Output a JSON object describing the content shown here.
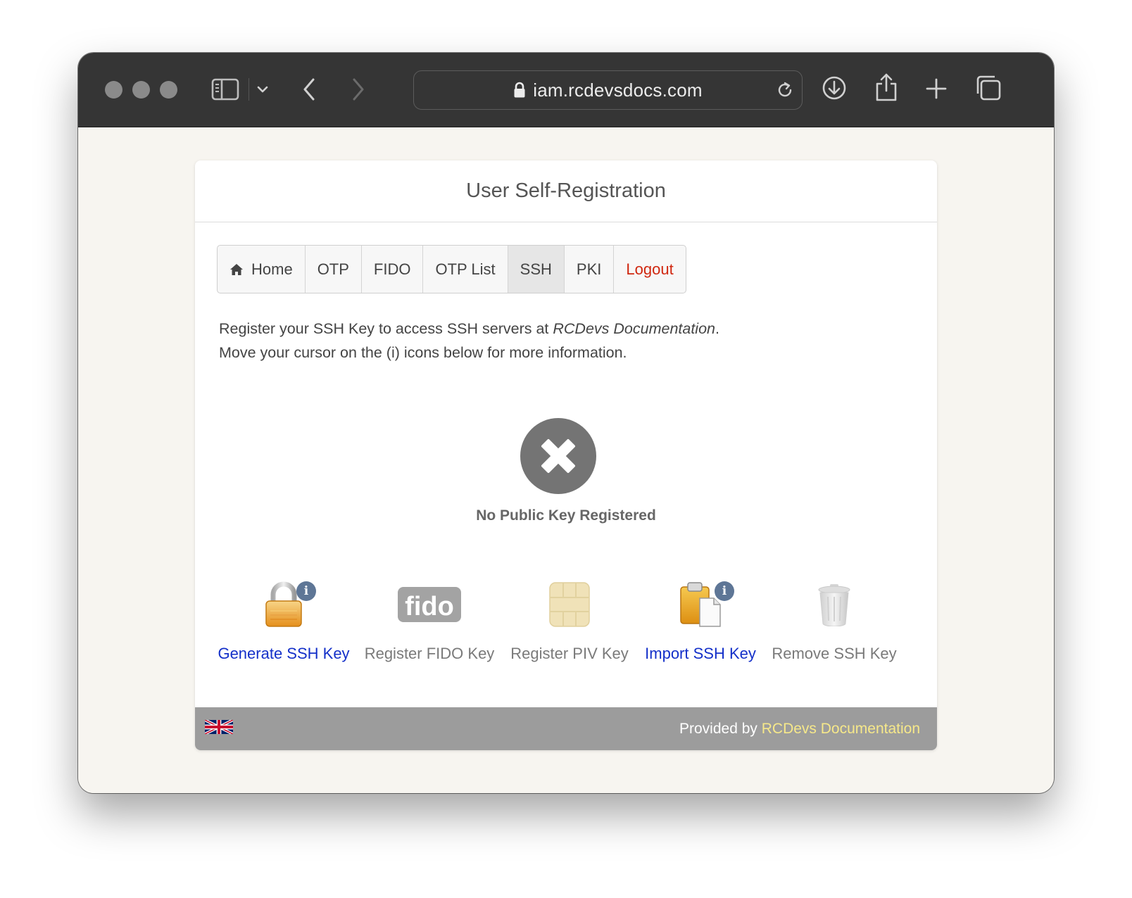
{
  "browser": {
    "url": "iam.rcdevsdocs.com",
    "icons": [
      "sidebar-icon",
      "chevron-down-icon",
      "back-icon",
      "forward-icon",
      "lock-icon",
      "reload-icon",
      "download-icon",
      "share-icon",
      "new-tab-icon",
      "tabs-overview-icon"
    ]
  },
  "page": {
    "title": "User Self-Registration",
    "nav": [
      {
        "label": "Home",
        "icon": "home-icon"
      },
      {
        "label": "OTP"
      },
      {
        "label": "FIDO"
      },
      {
        "label": "OTP List"
      },
      {
        "label": "SSH",
        "active": true
      },
      {
        "label": "PKI"
      },
      {
        "label": "Logout"
      }
    ],
    "intro_line1_prefix": "Register your SSH Key to access SSH servers at ",
    "intro_line1_org": "RCDevs Documentation",
    "intro_line1_suffix": ".",
    "intro_line2": "Move your cursor on the (i) icons below for more information.",
    "status_text": "No Public Key Registered",
    "actions": [
      {
        "label": "Generate SSH Key",
        "enabled": true,
        "icon": "padlock-icon",
        "info": true
      },
      {
        "label": "Register FIDO Key",
        "enabled": false,
        "icon": "fido-logo-icon",
        "info": false
      },
      {
        "label": "Register PIV Key",
        "enabled": false,
        "icon": "smartcard-chip-icon",
        "info": false
      },
      {
        "label": "Import SSH Key",
        "enabled": true,
        "icon": "clipboard-icon",
        "info": true
      },
      {
        "label": "Remove SSH Key",
        "enabled": false,
        "icon": "trash-can-icon",
        "info": false
      }
    ],
    "info_glyph": "i",
    "fido_logo_text": "fido",
    "footer": {
      "language_icon": "uk-flag-icon",
      "provided_by": "Provided by ",
      "provider": "RCDevs Documentation"
    }
  },
  "colors": {
    "toolbar": "#353535",
    "page_background": "#f7f5f0",
    "link_blue": "#1430c9",
    "logout_red": "#d0270f",
    "footer_gray": "#9c9c9c",
    "footer_link": "#f6e88a"
  }
}
